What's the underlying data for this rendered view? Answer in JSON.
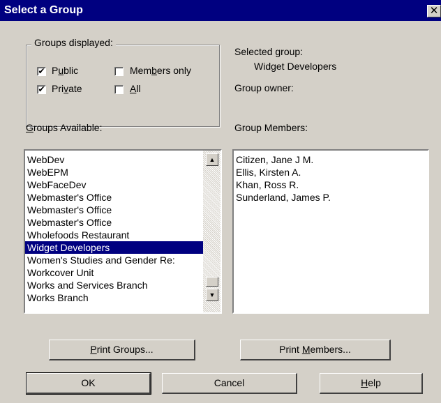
{
  "window": {
    "title": "Select a Group",
    "close_glyph": "✕"
  },
  "groups_displayed": {
    "legend": "Groups displayed:",
    "public": {
      "label_pre": "P",
      "label_u": "u",
      "label_post": "blic",
      "checked": true
    },
    "members_only": {
      "label_pre": "Mem",
      "label_u": "b",
      "label_post": "ers only",
      "checked": false
    },
    "private": {
      "label_pre": "Pri",
      "label_u": "v",
      "label_post": "ate",
      "checked": true
    },
    "all": {
      "label_pre": "",
      "label_u": "A",
      "label_post": "ll",
      "checked": false
    }
  },
  "selected_group": {
    "label": "Selected group:",
    "value": "Widget Developers"
  },
  "group_owner": {
    "label": "Group owner:"
  },
  "groups_available": {
    "label_u": "G",
    "label_post": "roups Available:",
    "items": [
      "WebDev",
      "WebEPM",
      "WebFaceDev",
      "Webmaster's Office",
      "Webmaster's Office",
      "Webmaster's Office",
      "Wholefoods Restaurant",
      "Widget Developers",
      "Women's Studies and Gender Re:",
      "Workcover Unit",
      "Works and Services Branch",
      "Works Branch"
    ],
    "selected_index": 7
  },
  "group_members": {
    "label": "Group Members:",
    "items": [
      "Citizen, Jane J M.",
      "Ellis, Kirsten A.",
      "Khan, Ross R.",
      "Sunderland, James P."
    ]
  },
  "buttons": {
    "print_groups": {
      "pre": "",
      "u": "P",
      "post": "rint Groups..."
    },
    "print_members": {
      "pre": "Print ",
      "u": "M",
      "post": "embers..."
    },
    "ok": "OK",
    "cancel": "Cancel",
    "help": {
      "pre": "",
      "u": "H",
      "post": "elp"
    }
  },
  "icons": {
    "check": "check-icon",
    "up": "scroll-up-arrow",
    "down": "scroll-down-arrow"
  }
}
